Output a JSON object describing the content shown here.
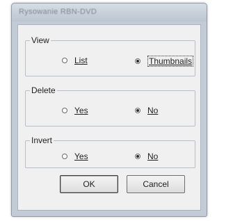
{
  "dialog": {
    "title": "Rysowanie RBN-DVD"
  },
  "groups": [
    {
      "label": "View",
      "options": [
        {
          "label": "List",
          "checked": false
        },
        {
          "label": "Thumbnails",
          "checked": true
        }
      ]
    },
    {
      "label": "Delete",
      "options": [
        {
          "label": "Yes",
          "checked": false
        },
        {
          "label": "No",
          "checked": true
        }
      ]
    },
    {
      "label": "Invert",
      "options": [
        {
          "label": "Yes",
          "checked": false
        },
        {
          "label": "No",
          "checked": true
        }
      ]
    }
  ],
  "buttons": {
    "ok_label": "OK",
    "cancel_label": "Cancel"
  }
}
